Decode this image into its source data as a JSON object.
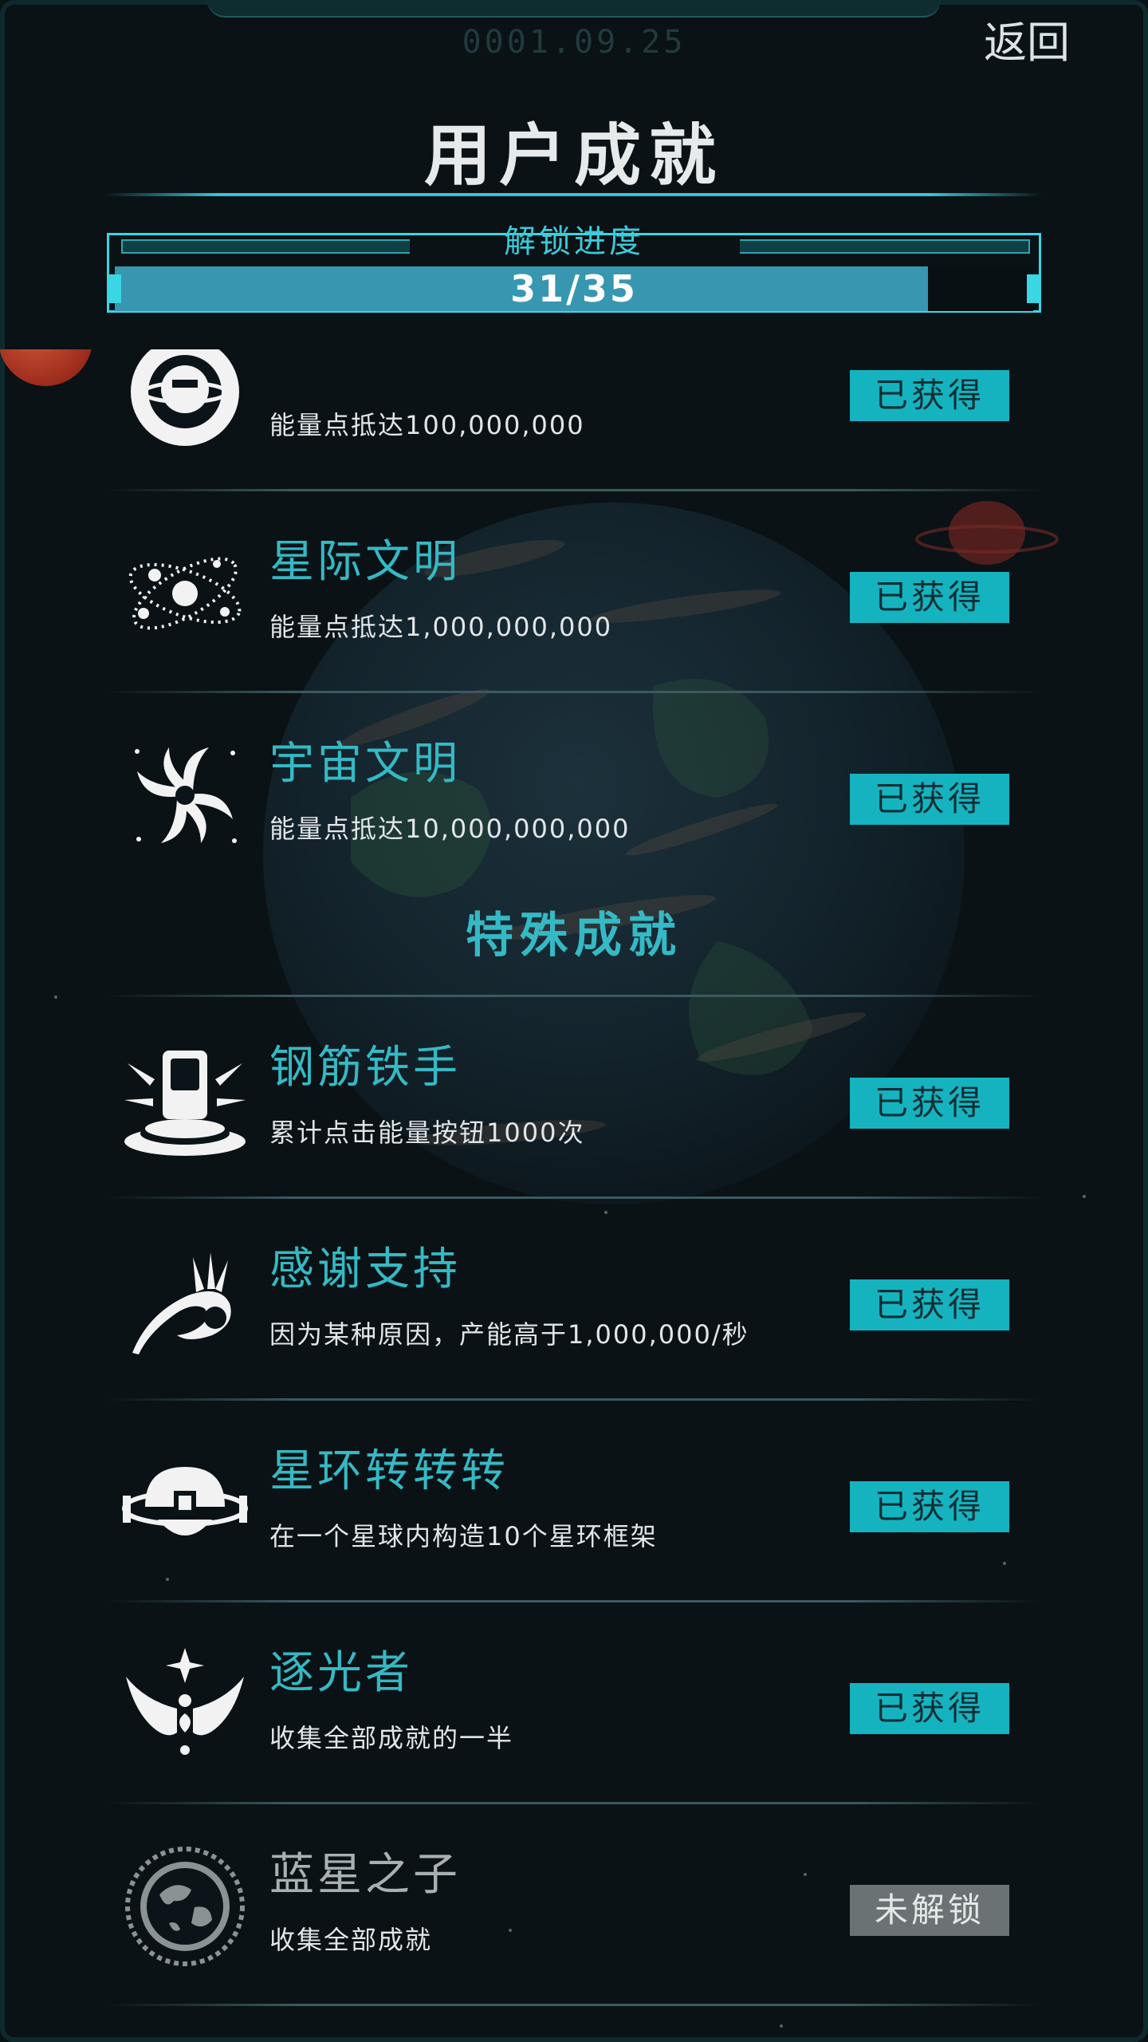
{
  "header": {
    "date": "0001.09.25",
    "back_label": "返回",
    "title": "用户成就"
  },
  "progress": {
    "label": "解锁进度",
    "text": "31/35",
    "unlocked": 31,
    "total": 35
  },
  "achievements_top": [
    {
      "name": "",
      "desc": "能量点抵达100,000,000",
      "status": "已获得",
      "icon": "ringed-planet-icon"
    },
    {
      "name": "星际文明",
      "desc": "能量点抵达1,000,000,000",
      "status": "已获得",
      "icon": "atom-orbit-icon"
    },
    {
      "name": "宇宙文明",
      "desc": "能量点抵达10,000,000,000",
      "status": "已获得",
      "icon": "galaxy-spiral-icon"
    }
  ],
  "special_section": {
    "title": "特殊成就"
  },
  "achievements_special": [
    {
      "name": "钢筋铁手",
      "desc": "累计点击能量按钮1000次",
      "status": "已获得",
      "icon": "pressed-button-icon"
    },
    {
      "name": "感谢支持",
      "desc": "因为某种原因，产能高于1,000,000/秒",
      "status": "已获得",
      "icon": "ok-hand-icon"
    },
    {
      "name": "星环转转转",
      "desc": "在一个星球内构造10个星环框架",
      "status": "已获得",
      "icon": "ring-frame-icon"
    },
    {
      "name": "逐光者",
      "desc": "收集全部成就的一半",
      "status": "已获得",
      "icon": "winged-star-icon"
    },
    {
      "name": "蓝星之子",
      "desc": "收集全部成就",
      "status": "未解锁",
      "icon": "earth-emblem-icon"
    }
  ]
}
